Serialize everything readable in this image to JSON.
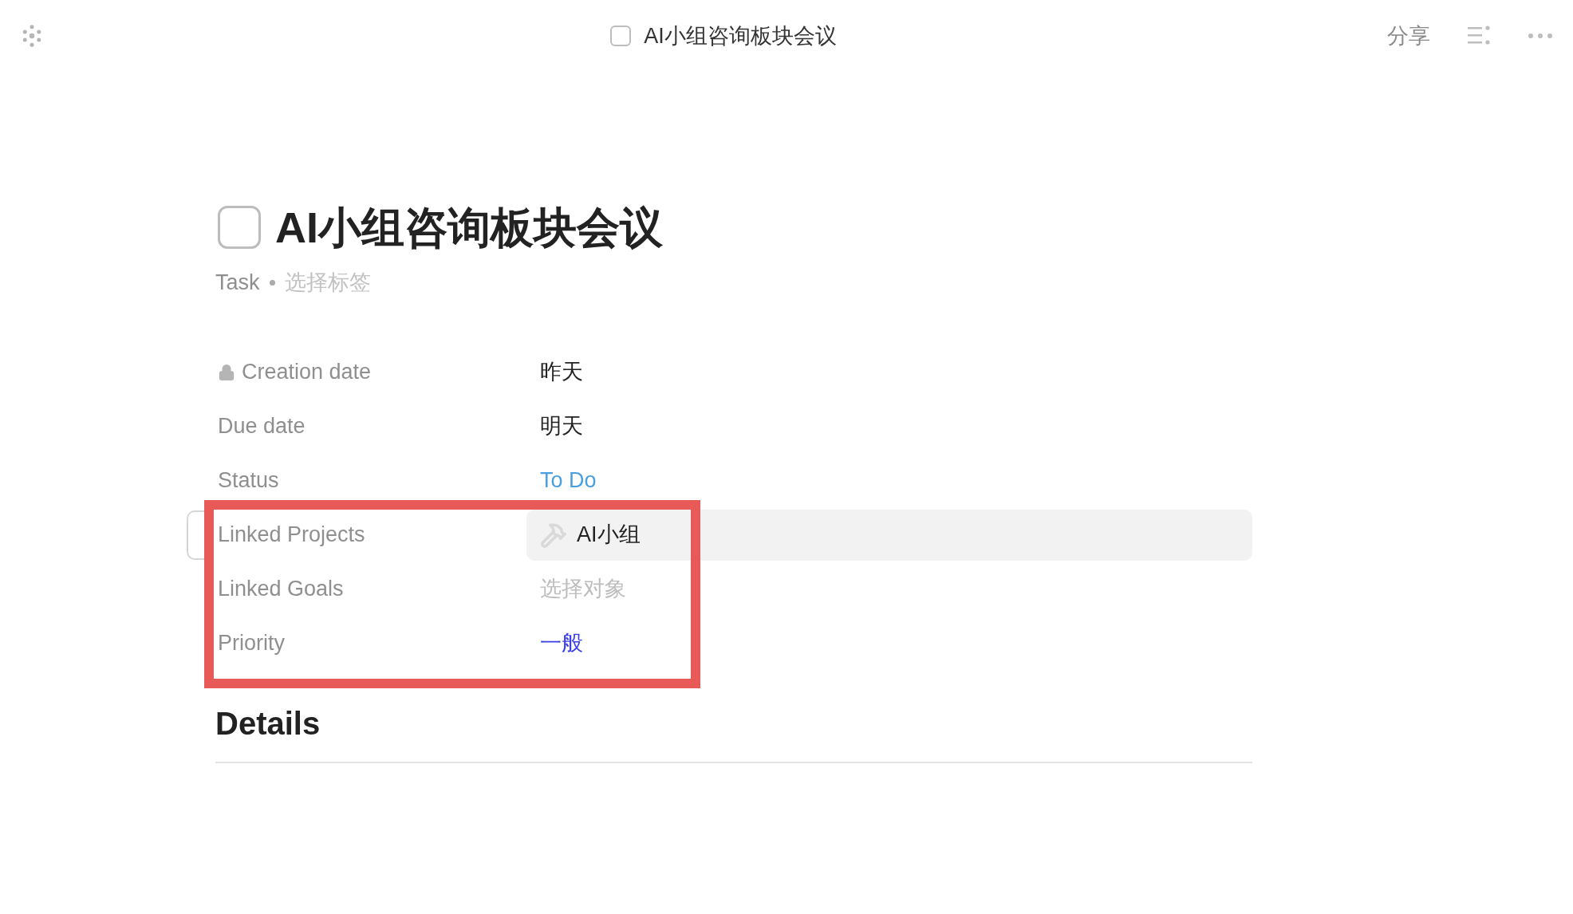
{
  "top_bar": {
    "title": "AI小组咨询板块会议",
    "checked": false,
    "share": "分享"
  },
  "task": {
    "title": "AI小组咨询板块会议",
    "checked": false,
    "type": "Task",
    "tag_placeholder": "选择标签"
  },
  "properties": [
    {
      "label": "Creation date",
      "locked": true,
      "kind": "text",
      "value": "昨天",
      "hovered": false
    },
    {
      "label": "Due date",
      "locked": false,
      "kind": "text",
      "value": "明天",
      "hovered": false
    },
    {
      "label": "Status",
      "locked": false,
      "kind": "status",
      "value": "To Do",
      "hovered": false
    },
    {
      "label": "Linked Projects",
      "locked": false,
      "kind": "relation",
      "value": "AI小组",
      "hovered": true
    },
    {
      "label": "Linked Goals",
      "locked": false,
      "kind": "placeholder",
      "value": "选择对象",
      "hovered": false
    },
    {
      "label": "Priority",
      "locked": false,
      "kind": "priority",
      "value": "一般",
      "hovered": false
    }
  ],
  "details": {
    "heading": "Details"
  }
}
